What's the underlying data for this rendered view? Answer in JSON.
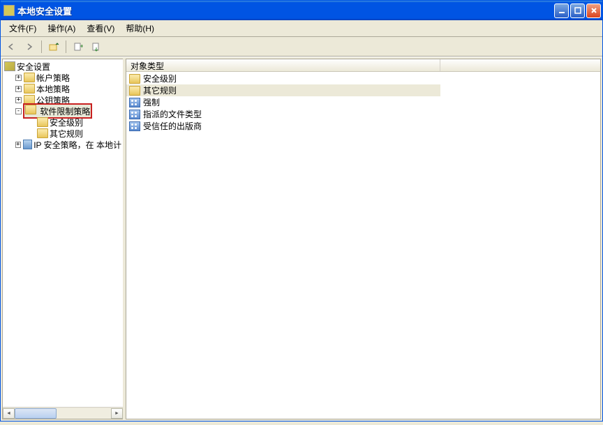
{
  "window": {
    "title": "本地安全设置"
  },
  "menubar": {
    "file": "文件(F)",
    "action": "操作(A)",
    "view": "查看(V)",
    "help": "帮助(H)"
  },
  "tree": {
    "root": "安全设置",
    "items": [
      {
        "label": "帐户策略",
        "expandable": true
      },
      {
        "label": "本地策略",
        "expandable": true
      },
      {
        "label": "公钥策略",
        "expandable": true
      },
      {
        "label": "软件限制策略",
        "expandable": true,
        "selected": true,
        "expanded": true,
        "children": [
          {
            "label": "安全级别"
          },
          {
            "label": "其它规则"
          }
        ]
      },
      {
        "label": "IP 安全策略，在 本地计",
        "expandable": true,
        "icon": "computer"
      }
    ]
  },
  "list": {
    "header": {
      "col1": "对象类型"
    },
    "items": [
      {
        "label": "安全级别",
        "icon": "folder"
      },
      {
        "label": "其它规则",
        "icon": "folder",
        "selected": true
      },
      {
        "label": "强制",
        "icon": "prop"
      },
      {
        "label": "指派的文件类型",
        "icon": "prop"
      },
      {
        "label": "受信任的出版商",
        "icon": "prop"
      }
    ]
  }
}
